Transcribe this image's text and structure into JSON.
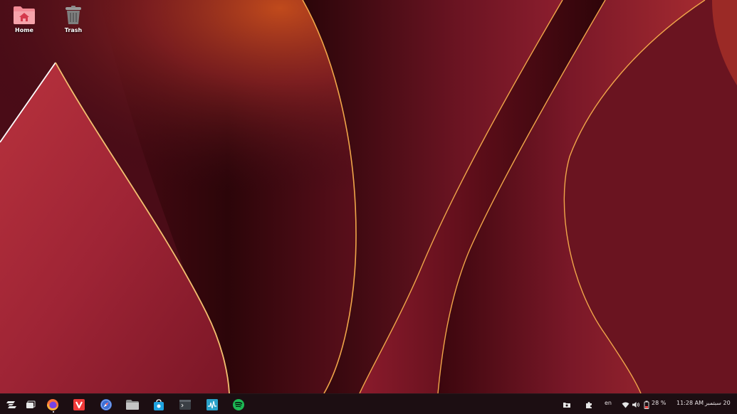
{
  "desktop": {
    "icons": [
      {
        "label": "Home",
        "icon": "folder-home-icon"
      },
      {
        "label": "Trash",
        "icon": "trash-icon"
      }
    ]
  },
  "taskbar": {
    "apps": [
      {
        "name": "start-menu",
        "icon": "zorin-logo-icon"
      },
      {
        "name": "workspaces",
        "icon": "workspace-switcher-icon"
      },
      {
        "name": "firefox",
        "icon": "firefox-icon",
        "running": true
      },
      {
        "name": "vivaldi",
        "icon": "vivaldi-icon"
      },
      {
        "name": "web-browser",
        "icon": "compass-icon"
      },
      {
        "name": "files",
        "icon": "folder-icon"
      },
      {
        "name": "software",
        "icon": "store-bag-icon"
      },
      {
        "name": "terminal",
        "icon": "terminal-icon"
      },
      {
        "name": "system-monitor",
        "icon": "monitor-icon"
      },
      {
        "name": "spotify",
        "icon": "spotify-icon"
      }
    ],
    "tray": {
      "language": "en",
      "battery": "28 %",
      "time": "11:28 AM",
      "date": "20 سبتمبر"
    }
  },
  "colors": {
    "accent": "#c3273f",
    "taskbar": "#1c0e12",
    "spotify": "#1db954",
    "vivaldi": "#ef3939",
    "folder_pink": "#f28b96"
  }
}
